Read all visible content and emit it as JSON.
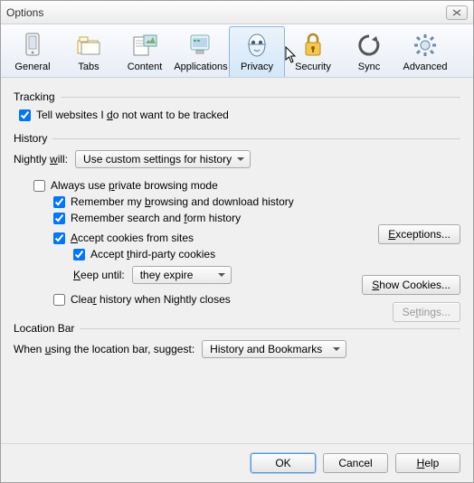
{
  "window": {
    "title": "Options"
  },
  "tabs": [
    {
      "label": "General"
    },
    {
      "label": "Tabs"
    },
    {
      "label": "Content"
    },
    {
      "label": "Applications"
    },
    {
      "label": "Privacy"
    },
    {
      "label": "Security"
    },
    {
      "label": "Sync"
    },
    {
      "label": "Advanced"
    }
  ],
  "tracking": {
    "section": "Tracking",
    "tell_prefix": "Tell websites I ",
    "tell_u": "d",
    "tell_suffix": "o not want to be tracked",
    "tell_checked": true
  },
  "history": {
    "section": "History",
    "nightly_prefix": "Nightly ",
    "nightly_u": "w",
    "nightly_suffix": "ill:",
    "nightly_value": "Use custom settings for history",
    "private_prefix": "Always use ",
    "private_u": "p",
    "private_suffix": "rivate browsing mode",
    "private_checked": false,
    "remember_browsing_prefix": "Remember my ",
    "remember_browsing_u": "b",
    "remember_browsing_suffix": "rowsing and download history",
    "remember_browsing_checked": true,
    "remember_forms_prefix": "Remember search and ",
    "remember_forms_u": "f",
    "remember_forms_suffix": "orm history",
    "remember_forms_checked": true,
    "accept_cookies_u": "A",
    "accept_cookies_suffix": "ccept cookies from sites",
    "accept_cookies_checked": true,
    "accept_third_prefix": "Accept ",
    "accept_third_u": "t",
    "accept_third_suffix": "hird-party cookies",
    "accept_third_checked": true,
    "keep_u": "K",
    "keep_suffix": "eep until:",
    "keep_value": "they expire",
    "clear_prefix": "Clea",
    "clear_u": "r",
    "clear_suffix": " history when Nightly closes",
    "clear_checked": false,
    "exceptions_u": "E",
    "exceptions_suffix": "xceptions...",
    "show_cookies_u": "S",
    "show_cookies_suffix": "how Cookies...",
    "settings_prefix": "Se",
    "settings_u": "t",
    "settings_suffix": "tings..."
  },
  "locationbar": {
    "section": "Location Bar",
    "suggest_prefix": "When ",
    "suggest_u": "u",
    "suggest_suffix": "sing the location bar, suggest:",
    "suggest_value": "History and Bookmarks"
  },
  "footer": {
    "ok": "OK",
    "cancel": "Cancel",
    "help_u": "H",
    "help_suffix": "elp"
  }
}
